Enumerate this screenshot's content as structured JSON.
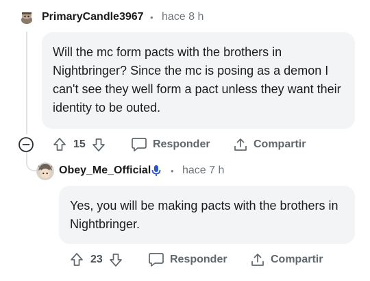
{
  "comments": [
    {
      "username": "PrimaryCandle3967",
      "separator": "•",
      "time": "hace 8 h",
      "body": "Will the mc form pacts with the brothers in Nightbringer? Since the mc is posing as a demon I can't see they well form a pact unless they want their identity to be outed.",
      "score": "15",
      "reply_label": "Responder",
      "share_label": "Compartir",
      "avatar_icon": "snoo-avatar-icon"
    },
    {
      "username": "Obey_Me_Official",
      "separator": "•",
      "time": "hace 7 h",
      "body": "Yes, you will be making pacts with the brothers in Nightbringer.",
      "score": "23",
      "reply_label": "Responder",
      "share_label": "Compartir",
      "avatar_icon": "anime-avatar-icon",
      "badge_icon": "microphone-icon"
    }
  ],
  "colors": {
    "bubble": "#f2f4f5",
    "meta_text": "#6d747a",
    "action_text": "#5f676d",
    "mic_badge": "#2e54d6"
  }
}
